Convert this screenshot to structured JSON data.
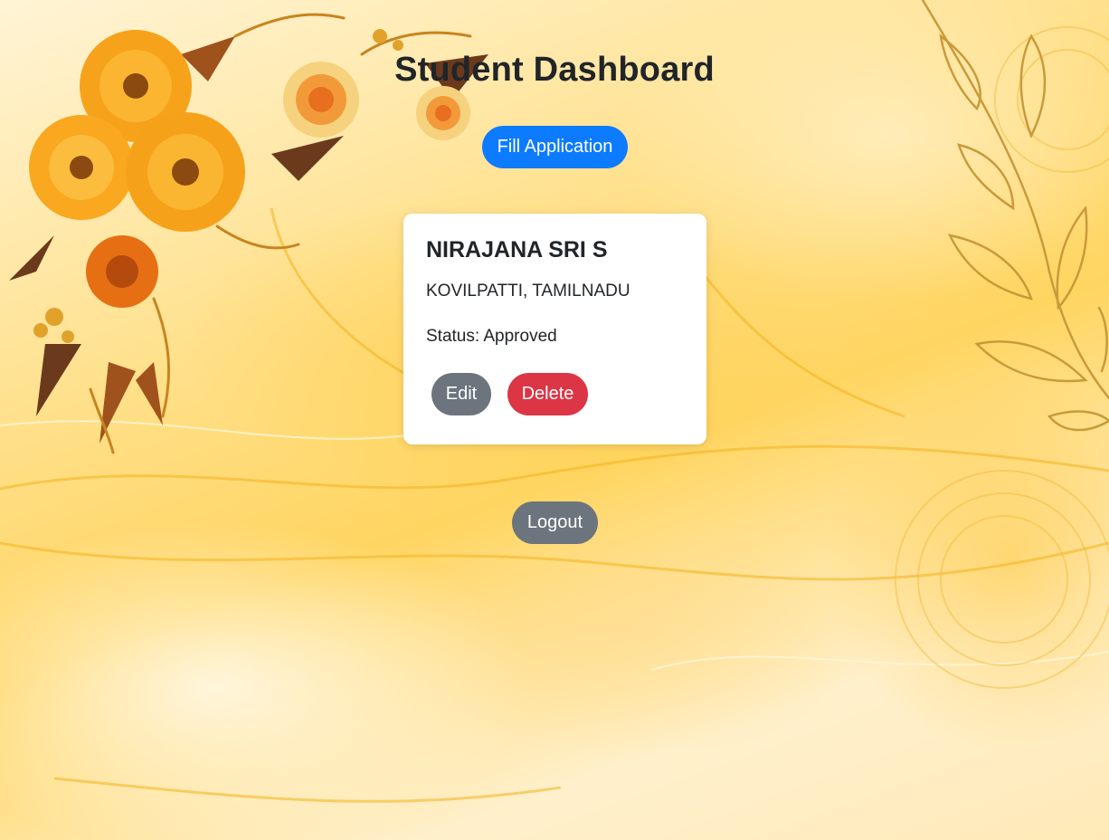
{
  "page": {
    "title": "Student Dashboard"
  },
  "actions": {
    "fill_application_label": "Fill Application",
    "logout_label": "Logout"
  },
  "application_card": {
    "name": "NIRAJANA SRI S",
    "location": "KOVILPATTI, TAMILNADU",
    "status_prefix": "Status: ",
    "status": "Approved",
    "edit_label": "Edit",
    "delete_label": "Delete"
  },
  "decor": {
    "left_art": "floral-bouquet",
    "right_art": "leaf-branch"
  },
  "colors": {
    "primary": "#0d7bff",
    "secondary": "#6c757d",
    "danger": "#dc3545",
    "background": "#ffd561"
  }
}
